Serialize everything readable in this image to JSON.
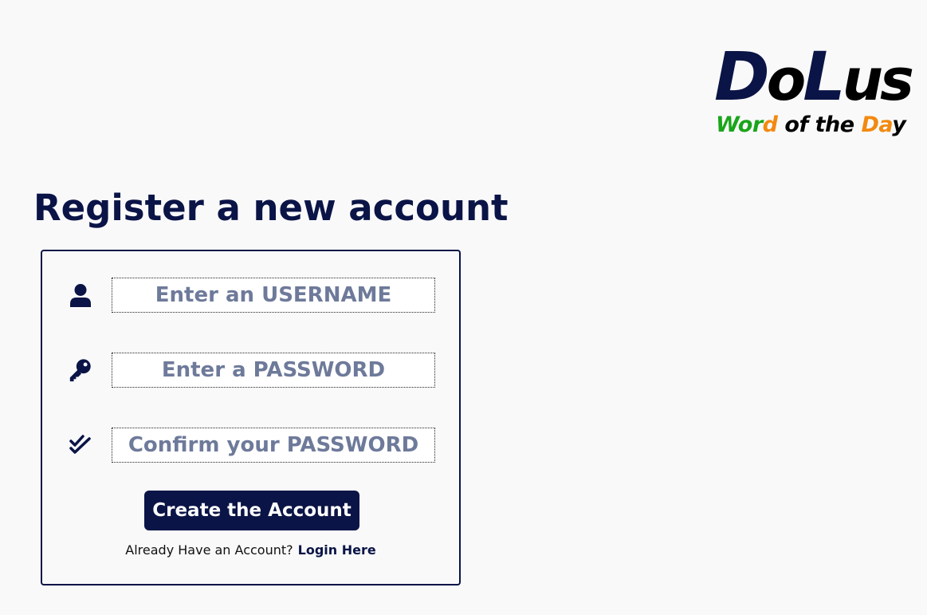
{
  "brand": {
    "logo_letters": [
      {
        "char": "D",
        "color": "#0a1446"
      },
      {
        "char": "o",
        "color": "#000000"
      },
      {
        "char": "L",
        "color": "#0a1446"
      },
      {
        "char": "us",
        "color": "#000000"
      }
    ],
    "tagline_parts": [
      {
        "text": "Wor",
        "color": "#1aa51a"
      },
      {
        "text": "d",
        "color": "#f28a10"
      },
      {
        "text": " of the ",
        "color": "#000000"
      },
      {
        "text": "Da",
        "color": "#f28a10"
      },
      {
        "text": "y",
        "color": "#000000"
      }
    ]
  },
  "page": {
    "title": "Register a new account"
  },
  "form": {
    "username": {
      "placeholder": "Enter an USERNAME",
      "value": "",
      "icon": "user-icon"
    },
    "password": {
      "placeholder": "Enter a PASSWORD",
      "value": "",
      "icon": "key-icon"
    },
    "confirm": {
      "placeholder": "Confirm your PASSWORD",
      "value": "",
      "icon": "double-check-icon"
    },
    "submit_label": "Create the Account",
    "login_prompt": "Already Have an Account?",
    "login_link": "Login Here"
  },
  "colors": {
    "primary": "#0a1446",
    "placeholder": "#6e7a9a",
    "background": "#f9f9fa",
    "green": "#1aa51a",
    "orange": "#f28a10"
  }
}
